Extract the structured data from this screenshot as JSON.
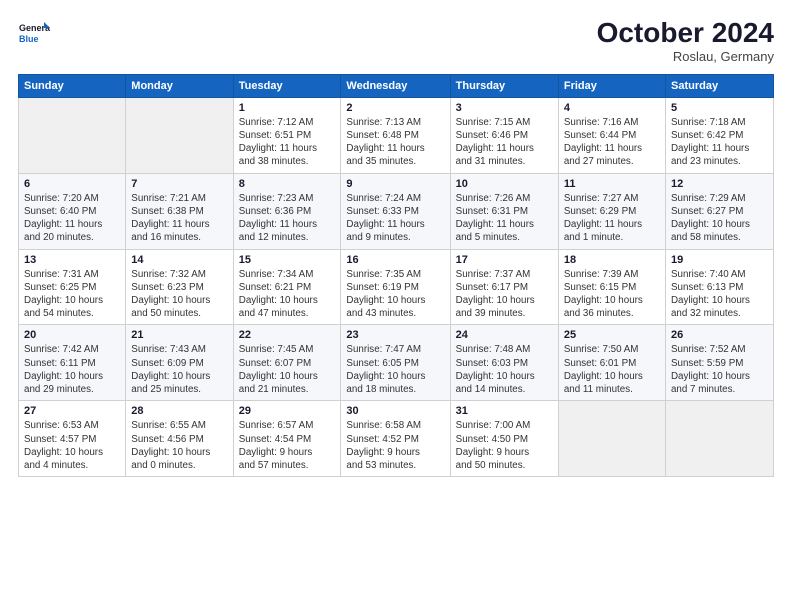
{
  "logo": {
    "line1": "General",
    "line2": "Blue"
  },
  "title": "October 2024",
  "location": "Roslau, Germany",
  "days_header": [
    "Sunday",
    "Monday",
    "Tuesday",
    "Wednesday",
    "Thursday",
    "Friday",
    "Saturday"
  ],
  "weeks": [
    [
      {
        "day": "",
        "content": ""
      },
      {
        "day": "",
        "content": ""
      },
      {
        "day": "1",
        "content": "Sunrise: 7:12 AM\nSunset: 6:51 PM\nDaylight: 11 hours\nand 38 minutes."
      },
      {
        "day": "2",
        "content": "Sunrise: 7:13 AM\nSunset: 6:48 PM\nDaylight: 11 hours\nand 35 minutes."
      },
      {
        "day": "3",
        "content": "Sunrise: 7:15 AM\nSunset: 6:46 PM\nDaylight: 11 hours\nand 31 minutes."
      },
      {
        "day": "4",
        "content": "Sunrise: 7:16 AM\nSunset: 6:44 PM\nDaylight: 11 hours\nand 27 minutes."
      },
      {
        "day": "5",
        "content": "Sunrise: 7:18 AM\nSunset: 6:42 PM\nDaylight: 11 hours\nand 23 minutes."
      }
    ],
    [
      {
        "day": "6",
        "content": "Sunrise: 7:20 AM\nSunset: 6:40 PM\nDaylight: 11 hours\nand 20 minutes."
      },
      {
        "day": "7",
        "content": "Sunrise: 7:21 AM\nSunset: 6:38 PM\nDaylight: 11 hours\nand 16 minutes."
      },
      {
        "day": "8",
        "content": "Sunrise: 7:23 AM\nSunset: 6:36 PM\nDaylight: 11 hours\nand 12 minutes."
      },
      {
        "day": "9",
        "content": "Sunrise: 7:24 AM\nSunset: 6:33 PM\nDaylight: 11 hours\nand 9 minutes."
      },
      {
        "day": "10",
        "content": "Sunrise: 7:26 AM\nSunset: 6:31 PM\nDaylight: 11 hours\nand 5 minutes."
      },
      {
        "day": "11",
        "content": "Sunrise: 7:27 AM\nSunset: 6:29 PM\nDaylight: 11 hours\nand 1 minute."
      },
      {
        "day": "12",
        "content": "Sunrise: 7:29 AM\nSunset: 6:27 PM\nDaylight: 10 hours\nand 58 minutes."
      }
    ],
    [
      {
        "day": "13",
        "content": "Sunrise: 7:31 AM\nSunset: 6:25 PM\nDaylight: 10 hours\nand 54 minutes."
      },
      {
        "day": "14",
        "content": "Sunrise: 7:32 AM\nSunset: 6:23 PM\nDaylight: 10 hours\nand 50 minutes."
      },
      {
        "day": "15",
        "content": "Sunrise: 7:34 AM\nSunset: 6:21 PM\nDaylight: 10 hours\nand 47 minutes."
      },
      {
        "day": "16",
        "content": "Sunrise: 7:35 AM\nSunset: 6:19 PM\nDaylight: 10 hours\nand 43 minutes."
      },
      {
        "day": "17",
        "content": "Sunrise: 7:37 AM\nSunset: 6:17 PM\nDaylight: 10 hours\nand 39 minutes."
      },
      {
        "day": "18",
        "content": "Sunrise: 7:39 AM\nSunset: 6:15 PM\nDaylight: 10 hours\nand 36 minutes."
      },
      {
        "day": "19",
        "content": "Sunrise: 7:40 AM\nSunset: 6:13 PM\nDaylight: 10 hours\nand 32 minutes."
      }
    ],
    [
      {
        "day": "20",
        "content": "Sunrise: 7:42 AM\nSunset: 6:11 PM\nDaylight: 10 hours\nand 29 minutes."
      },
      {
        "day": "21",
        "content": "Sunrise: 7:43 AM\nSunset: 6:09 PM\nDaylight: 10 hours\nand 25 minutes."
      },
      {
        "day": "22",
        "content": "Sunrise: 7:45 AM\nSunset: 6:07 PM\nDaylight: 10 hours\nand 21 minutes."
      },
      {
        "day": "23",
        "content": "Sunrise: 7:47 AM\nSunset: 6:05 PM\nDaylight: 10 hours\nand 18 minutes."
      },
      {
        "day": "24",
        "content": "Sunrise: 7:48 AM\nSunset: 6:03 PM\nDaylight: 10 hours\nand 14 minutes."
      },
      {
        "day": "25",
        "content": "Sunrise: 7:50 AM\nSunset: 6:01 PM\nDaylight: 10 hours\nand 11 minutes."
      },
      {
        "day": "26",
        "content": "Sunrise: 7:52 AM\nSunset: 5:59 PM\nDaylight: 10 hours\nand 7 minutes."
      }
    ],
    [
      {
        "day": "27",
        "content": "Sunrise: 6:53 AM\nSunset: 4:57 PM\nDaylight: 10 hours\nand 4 minutes."
      },
      {
        "day": "28",
        "content": "Sunrise: 6:55 AM\nSunset: 4:56 PM\nDaylight: 10 hours\nand 0 minutes."
      },
      {
        "day": "29",
        "content": "Sunrise: 6:57 AM\nSunset: 4:54 PM\nDaylight: 9 hours\nand 57 minutes."
      },
      {
        "day": "30",
        "content": "Sunrise: 6:58 AM\nSunset: 4:52 PM\nDaylight: 9 hours\nand 53 minutes."
      },
      {
        "day": "31",
        "content": "Sunrise: 7:00 AM\nSunset: 4:50 PM\nDaylight: 9 hours\nand 50 minutes."
      },
      {
        "day": "",
        "content": ""
      },
      {
        "day": "",
        "content": ""
      }
    ]
  ]
}
